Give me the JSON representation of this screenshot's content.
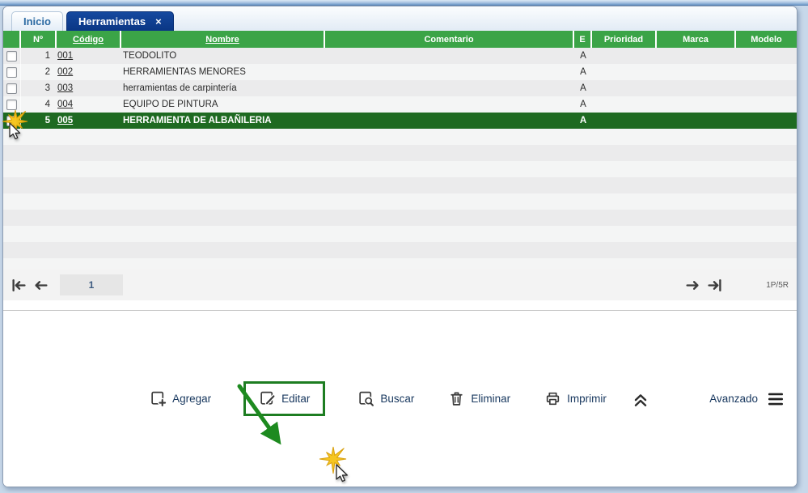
{
  "tabs": [
    {
      "label": "Inicio",
      "active": false
    },
    {
      "label": "Herramientas",
      "active": true,
      "close_label": "×"
    }
  ],
  "table": {
    "columns": [
      {
        "label": ""
      },
      {
        "label": "Nº"
      },
      {
        "label": "Código",
        "sortable": true
      },
      {
        "label": "Nombre",
        "sortable": true
      },
      {
        "label": "Comentario"
      },
      {
        "label": "E"
      },
      {
        "label": "Prioridad"
      },
      {
        "label": "Marca"
      },
      {
        "label": "Modelo"
      }
    ],
    "rows": [
      {
        "n": "1",
        "codigo": "001",
        "nombre": "TEODOLITO",
        "comentario": "",
        "e": "A",
        "prioridad": "",
        "marca": "",
        "modelo": "",
        "selected": false
      },
      {
        "n": "2",
        "codigo": "002",
        "nombre": "HERRAMIENTAS MENORES",
        "comentario": "",
        "e": "A",
        "prioridad": "",
        "marca": "",
        "modelo": "",
        "selected": false
      },
      {
        "n": "3",
        "codigo": "003",
        "nombre": "herramientas de carpintería",
        "comentario": "",
        "e": "A",
        "prioridad": "",
        "marca": "",
        "modelo": "",
        "selected": false
      },
      {
        "n": "4",
        "codigo": "004",
        "nombre": "EQUIPO DE PINTURA",
        "comentario": "",
        "e": "A",
        "prioridad": "",
        "marca": "",
        "modelo": "",
        "selected": false
      },
      {
        "n": "5",
        "codigo": "005",
        "nombre": "HERRAMIENTA DE ALBAÑILERIA",
        "comentario": "",
        "e": "A",
        "prioridad": "",
        "marca": "",
        "modelo": "",
        "selected": true
      }
    ]
  },
  "pagination": {
    "page": "1",
    "info": "1P/5R",
    "icons": [
      "first-page-icon",
      "prev-page-icon",
      "next-page-icon",
      "last-page-icon"
    ]
  },
  "toolbar": {
    "buttons": [
      {
        "label": "Agregar",
        "icon": "add-square-icon"
      },
      {
        "label": "Editar",
        "icon": "edit-square-icon",
        "highlighted": true
      },
      {
        "label": "Buscar",
        "icon": "search-square-icon"
      },
      {
        "label": "Eliminar",
        "icon": "trash-icon"
      },
      {
        "label": "Imprimir",
        "icon": "printer-icon"
      }
    ],
    "collapse_icon": "chevron-double-up-icon",
    "advanced_label": "Avanzado",
    "menu_icon": "hamburger-menu-icon"
  },
  "colors": {
    "header_green": "#3ba447",
    "selected_row_green": "#1e6a21",
    "active_tab_navy": "#0a3684",
    "annotation_green": "#1d8a1f",
    "label_navy": "#17375e",
    "click_burst_yellow": "#f6c51b"
  }
}
